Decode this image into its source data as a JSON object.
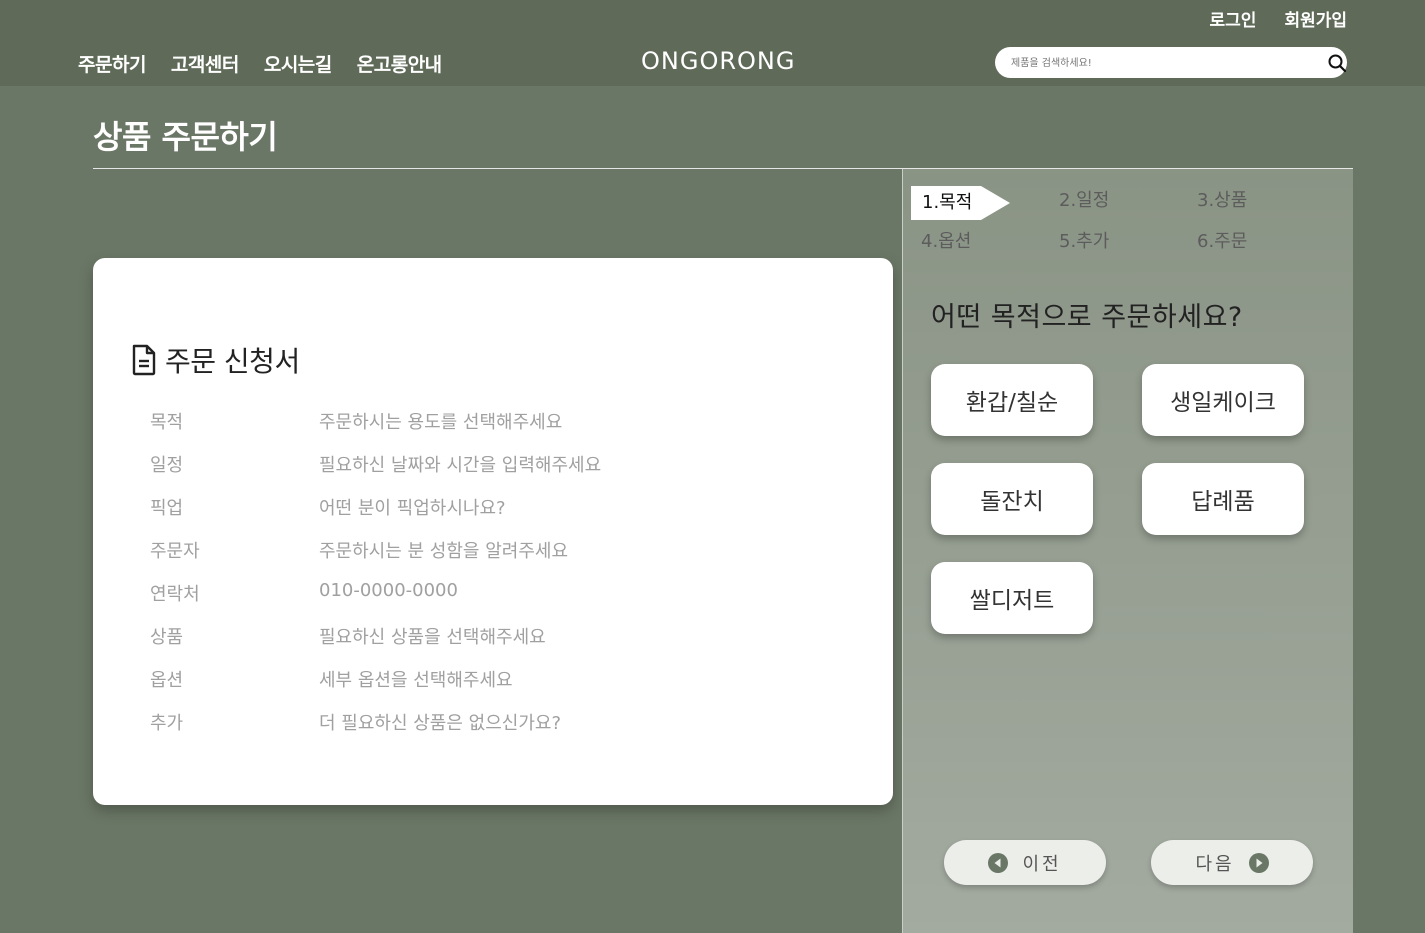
{
  "header": {
    "top_links": {
      "login": "로그인",
      "signup": "회원가입"
    },
    "nav": [
      "주문하기",
      "고객센터",
      "오시는길",
      "온고롱안내"
    ],
    "logo": "ONGORONG",
    "search": {
      "placeholder": "제품을 검색하세요!",
      "icon": "search-icon"
    }
  },
  "page": {
    "title": "상품 주문하기"
  },
  "card": {
    "title": "주문 신청서",
    "icon": "document-icon",
    "rows": [
      {
        "label": "목적",
        "value": "주문하시는 용도를 선택해주세요"
      },
      {
        "label": "일정",
        "value": "필요하신 날짜와 시간을 입력해주세요"
      },
      {
        "label": "픽업",
        "value": "어떤 분이 픽업하시나요?"
      },
      {
        "label": "주문자",
        "value": "주문하시는 분 성함을 알려주세요"
      },
      {
        "label": "연락처",
        "value": "010-0000-0000"
      },
      {
        "label": "상품",
        "value": "필요하신 상품을 선택해주세요"
      },
      {
        "label": "옵션",
        "value": "세부 옵션을 선택해주세요"
      },
      {
        "label": "추가",
        "value": "더 필요하신 상품은 없으신가요?"
      }
    ]
  },
  "panel": {
    "steps": [
      "1.목적",
      "2.일정",
      "3.상품",
      "4.옵션",
      "5.추가",
      "6.주문"
    ],
    "active_step": "1.목적",
    "question": "어떤 목적으로 주문하세요?",
    "options": [
      "환갑/칠순",
      "생일케이크",
      "돌잔치",
      "답례품",
      "쌀디저트"
    ],
    "prev_label": "이전",
    "next_label": "다음"
  },
  "colors": {
    "background": "#6b7766",
    "header": "#5f6b58",
    "panel_top": "#8a9485",
    "panel_bottom": "#a3aaa0",
    "card": "#ffffff",
    "muted_text": "#a0a0a0"
  }
}
